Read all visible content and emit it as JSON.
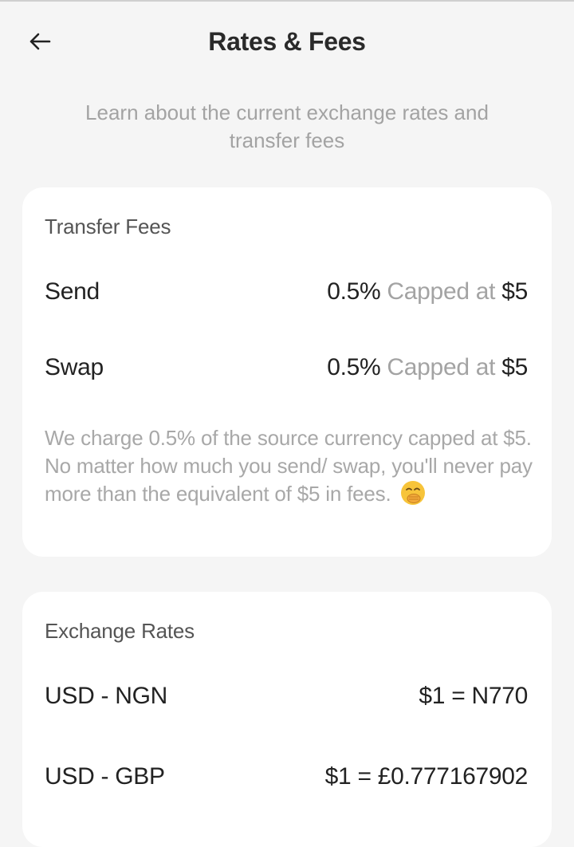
{
  "header": {
    "back_icon": "arrow-left-icon",
    "title": "Rates & Fees",
    "subtitle": "Learn about the current exchange rates and transfer fees"
  },
  "transfer_fees": {
    "title": "Transfer Fees",
    "rows": [
      {
        "label": "Send",
        "percent": "0.5%",
        "cap_text": "Capped at",
        "cap_amount": "$5"
      },
      {
        "label": "Swap",
        "percent": "0.5%",
        "cap_text": "Capped at",
        "cap_amount": "$5"
      }
    ],
    "note": "We charge 0.5% of the source currency capped at $5. No matter how much you send/ swap, you'll never pay more than the equivalent of $5 in fees.",
    "note_emoji": "hand-over-mouth-emoji"
  },
  "exchange_rates": {
    "title": "Exchange Rates",
    "rows": [
      {
        "pair": "USD - NGN",
        "rate": "$1 = N770"
      },
      {
        "pair": "USD - GBP",
        "rate": "$1 = £0.777167902"
      }
    ]
  },
  "colors": {
    "background": "#f5f5f5",
    "card": "#ffffff",
    "muted_text": "#a3a3a3",
    "primary_text": "#222222"
  }
}
